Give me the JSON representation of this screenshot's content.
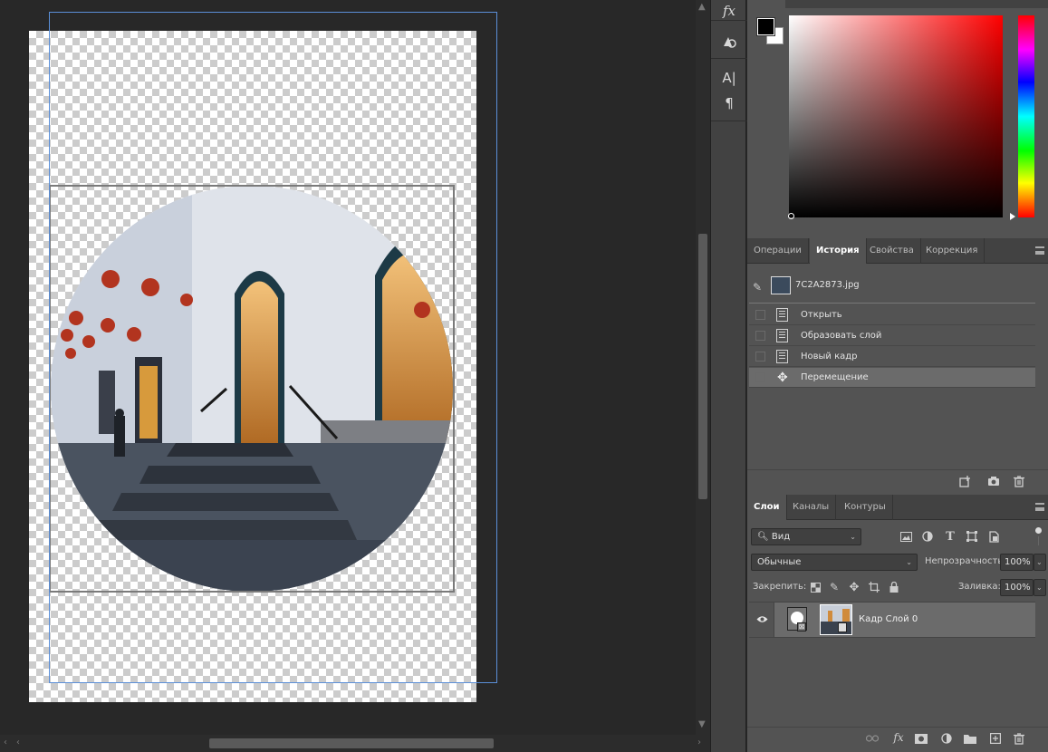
{
  "history_panel": {
    "tabs": [
      "Операции",
      "История",
      "Свойства",
      "Коррекция"
    ],
    "active_tab": "История",
    "snapshot_label": "7C2A2873.jpg",
    "items": [
      {
        "label": "Открыть",
        "icon": "document-icon"
      },
      {
        "label": "Образовать слой",
        "icon": "document-icon"
      },
      {
        "label": "Новый кадр",
        "icon": "document-icon"
      },
      {
        "label": "Перемещение",
        "icon": "move-icon",
        "selected": true
      }
    ]
  },
  "layers_panel": {
    "tabs": [
      "Слои",
      "Каналы",
      "Контуры"
    ],
    "active_tab": "Слои",
    "filter_label": "Вид",
    "blend_mode": "Обычные",
    "opacity_label": "Непрозрачность:",
    "opacity_value": "100%",
    "lock_label": "Закрепить:",
    "fill_label": "Заливка:",
    "fill_value": "100%",
    "layers": [
      {
        "name": "Кадр Слой 0",
        "visible": true
      }
    ]
  },
  "colors": {
    "foreground": "#000000",
    "background": "#ffffff",
    "selected_row": "#6b6b6b",
    "guide": "#5b8fd8"
  }
}
